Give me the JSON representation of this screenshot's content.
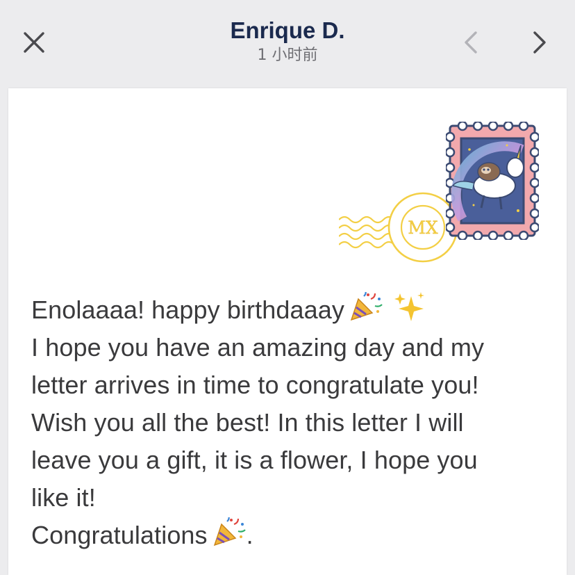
{
  "header": {
    "title": "Enrique D.",
    "subtitle": "1 小时前",
    "close_icon": "close-icon",
    "prev_icon": "chevron-left-icon",
    "next_icon": "chevron-right-icon"
  },
  "letter": {
    "stamp": {
      "icon": "sloth-unicorn-stamp",
      "frame_color": "#f2a9ad",
      "border_color": "#3b4a72"
    },
    "postmark": {
      "text": "MX",
      "color": "#f3cf45"
    },
    "lines": [
      "Enolaaaa! happy birthdaaay",
      "I hope you have an amazing day and my",
      "letter arrives in time to congratulate you!",
      "Wish you all the best! In this letter I will",
      "leave you a gift, it is a flower, I hope you",
      "like it!",
      "Congratulations",
      "."
    ],
    "emojis": [
      "party-popper-icon",
      "sparkles-icon"
    ]
  }
}
